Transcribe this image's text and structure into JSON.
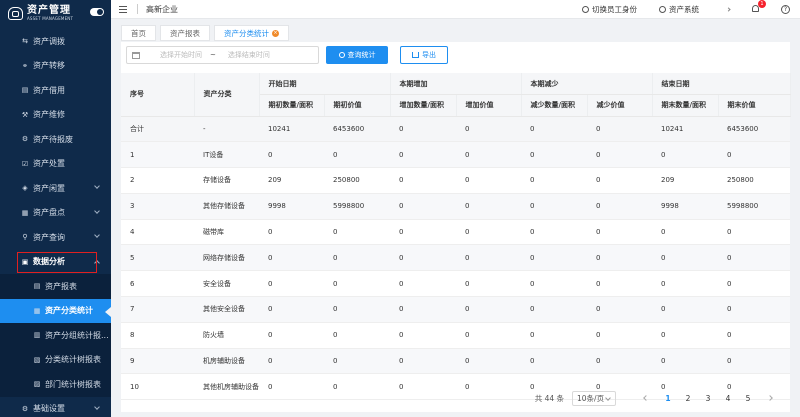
{
  "logo": {
    "title": "资产管理",
    "subtitle": "ASSET MANAGEMENT"
  },
  "sidebar": {
    "items": [
      {
        "label": "资产调拨",
        "icon": "transfer-icon",
        "glyph": "⇆",
        "chevron": false
      },
      {
        "label": "资产转移",
        "icon": "link-icon",
        "glyph": "⚭",
        "chevron": false
      },
      {
        "label": "资产借用",
        "icon": "document-icon",
        "glyph": "▤",
        "chevron": false
      },
      {
        "label": "资产维修",
        "icon": "wrench-icon",
        "glyph": "⚒",
        "chevron": false
      },
      {
        "label": "资产待报废",
        "icon": "recycle-icon",
        "glyph": "⚙",
        "chevron": false
      },
      {
        "label": "资产处置",
        "icon": "check-icon",
        "glyph": "☑",
        "chevron": false
      },
      {
        "label": "资产闲置",
        "icon": "box-icon",
        "glyph": "◈",
        "chevron": true
      },
      {
        "label": "资产盘点",
        "icon": "clipboard-icon",
        "glyph": "▦",
        "chevron": true
      },
      {
        "label": "资产查询",
        "icon": "search-icon",
        "glyph": "⚲",
        "chevron": true
      }
    ],
    "section": {
      "label": "数据分析",
      "icon": "analysis-icon",
      "glyph": "▣"
    },
    "sub_items": [
      {
        "label": "资产报表",
        "icon": "report-icon",
        "glyph": "▤",
        "active": false
      },
      {
        "label": "资产分类统计",
        "icon": "category-icon",
        "glyph": "▦",
        "active": true
      },
      {
        "label": "资产分组统计报...",
        "icon": "group-icon",
        "glyph": "▥",
        "active": false
      },
      {
        "label": "分类统计树报表",
        "icon": "tree-icon",
        "glyph": "▧",
        "active": false
      },
      {
        "label": "部门统计树报表",
        "icon": "dept-icon",
        "glyph": "▨",
        "active": false
      }
    ],
    "bottom": {
      "label": "基础设置",
      "icon": "settings-icon",
      "glyph": "⚙"
    }
  },
  "topbar": {
    "company": "高新企业",
    "switch_role": "切换员工身份",
    "system": "资产系统",
    "badge": "1",
    "help": "?"
  },
  "tabs": [
    {
      "label": "首页",
      "active": false
    },
    {
      "label": "资产报表",
      "active": false
    },
    {
      "label": "资产分类统计",
      "active": true
    }
  ],
  "filter": {
    "start_placeholder": "选择开始时间",
    "tilde": "~",
    "end_placeholder": "选择结束时间",
    "query_label": "查询统计",
    "export_label": "导出"
  },
  "table": {
    "group_headers": [
      "序号",
      "资产分类",
      "开始日期",
      "本期增加",
      "本期减少",
      "结束日期"
    ],
    "sub_headers": [
      "期初数量/面积",
      "期初价值",
      "增加数量/面积",
      "增加价值",
      "减少数量/面积",
      "减少价值",
      "期末数量/面积",
      "期末价值"
    ],
    "rows": [
      [
        "合计",
        "-",
        "10241",
        "6453600",
        "0",
        "0",
        "0",
        "0",
        "10241",
        "6453600"
      ],
      [
        "1",
        "IT设备",
        "0",
        "0",
        "0",
        "0",
        "0",
        "0",
        "0",
        "0"
      ],
      [
        "2",
        "存储设备",
        "209",
        "250800",
        "0",
        "0",
        "0",
        "0",
        "209",
        "250800"
      ],
      [
        "3",
        "其他存储设备",
        "9998",
        "5998800",
        "0",
        "0",
        "0",
        "0",
        "9998",
        "5998800"
      ],
      [
        "4",
        "磁带库",
        "0",
        "0",
        "0",
        "0",
        "0",
        "0",
        "0",
        "0"
      ],
      [
        "5",
        "网络存储设备",
        "0",
        "0",
        "0",
        "0",
        "0",
        "0",
        "0",
        "0"
      ],
      [
        "6",
        "安全设备",
        "0",
        "0",
        "0",
        "0",
        "0",
        "0",
        "0",
        "0"
      ],
      [
        "7",
        "其他安全设备",
        "0",
        "0",
        "0",
        "0",
        "0",
        "0",
        "0",
        "0"
      ],
      [
        "8",
        "防火墙",
        "0",
        "0",
        "0",
        "0",
        "0",
        "0",
        "0",
        "0"
      ],
      [
        "9",
        "机房辅助设备",
        "0",
        "0",
        "0",
        "0",
        "0",
        "0",
        "0",
        "0"
      ],
      [
        "10",
        "其他机房辅助设备",
        "0",
        "0",
        "0",
        "0",
        "0",
        "0",
        "0",
        "0"
      ]
    ]
  },
  "pager": {
    "total": "共 44 条",
    "page_size": "10条/页",
    "pages": [
      "1",
      "2",
      "3",
      "4",
      "5"
    ],
    "current": "1"
  },
  "colors": {
    "sidebar": "#0f2a4a",
    "accent": "#1e8ef0",
    "highlight_box": "#e02020",
    "tab_badge": "#f08a2a"
  }
}
